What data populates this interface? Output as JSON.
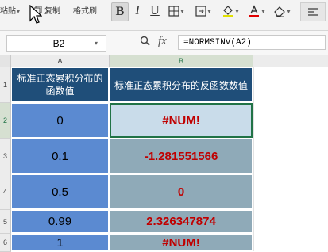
{
  "toolbar": {
    "paste_label": "粘贴",
    "copy_label": "复制",
    "format_painter_label": "格式刷",
    "bold_label": "B",
    "italic_label": "I",
    "underline_label": "U"
  },
  "formula_bar": {
    "name_box": "B2",
    "fx_label": "fx",
    "formula": "=NORMSINV(A2)"
  },
  "sheet": {
    "columns": [
      "A",
      "B"
    ],
    "rows": [
      "1",
      "2",
      "3",
      "4",
      "5",
      "6"
    ],
    "header_a": "标准正态累积分布的函数值",
    "header_b": "标准正态累积分布的反函数数值",
    "data": [
      {
        "a": "0",
        "b": "#NUM!"
      },
      {
        "a": "0.1",
        "b": "-1.281551566"
      },
      {
        "a": "0.5",
        "b": "0"
      },
      {
        "a": "0.99",
        "b": "2.326347874"
      },
      {
        "a": "1",
        "b": "#NUM!"
      }
    ]
  },
  "colors": {
    "header_bg": "#1f4e79",
    "col_a_bg": "#5b8ad1",
    "col_b_bg": "#8faab8",
    "result_text": "#c00000",
    "selection": "#217346"
  }
}
